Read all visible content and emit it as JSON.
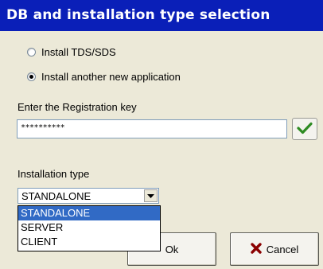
{
  "window": {
    "title": "DB and installation type selection"
  },
  "options": {
    "install_tds": "Install TDS/SDS",
    "install_new": "Install another new application",
    "selected": "install_new"
  },
  "registration": {
    "label": "Enter the Registration key",
    "value": "**********",
    "confirm_icon": "checkmark-icon",
    "accent": "#2e8b22"
  },
  "installation": {
    "label": "Installation type",
    "selected": "STANDALONE",
    "options": [
      "STANDALONE",
      "SERVER",
      "CLIENT"
    ],
    "highlight_color": "#316ac5"
  },
  "buttons": {
    "ok": "Ok",
    "cancel": "Cancel",
    "cancel_icon": "x-icon",
    "cancel_icon_color": "#8b0000"
  }
}
